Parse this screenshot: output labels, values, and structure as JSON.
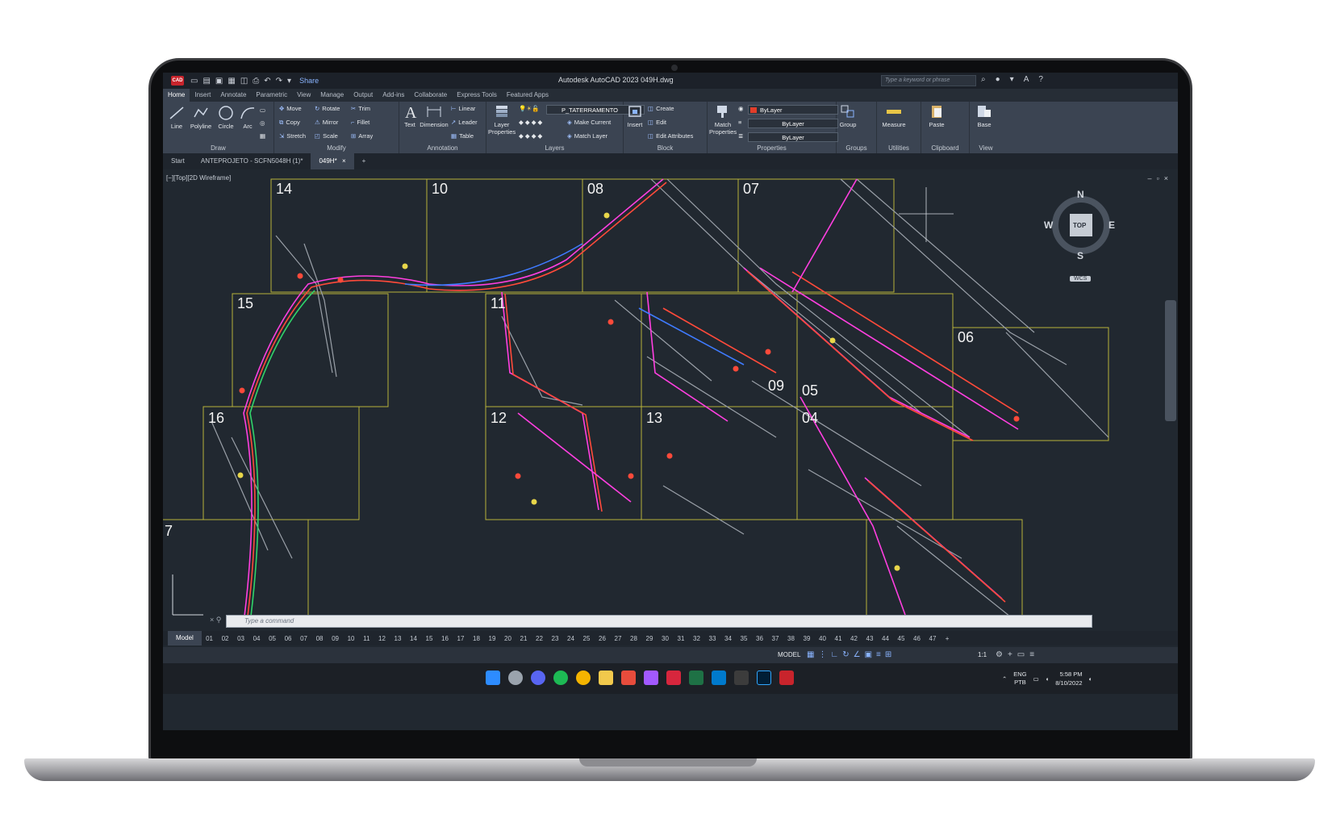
{
  "titlebar": {
    "logo": "CAD",
    "share": "Share",
    "title": "Autodesk AutoCAD 2023    049H.dwg",
    "search_placeholder": "Type a keyword or phrase"
  },
  "ribbon_tabs": [
    "Home",
    "Insert",
    "Annotate",
    "Parametric",
    "View",
    "Manage",
    "Output",
    "Add-ins",
    "Collaborate",
    "Express Tools",
    "Featured Apps"
  ],
  "draw": {
    "title": "Draw",
    "tools": [
      "Line",
      "Polyline",
      "Circle",
      "Arc"
    ]
  },
  "modify": {
    "title": "Modify",
    "col1": [
      "Move",
      "Copy",
      "Stretch"
    ],
    "col2": [
      "Rotate",
      "Mirror",
      "Scale"
    ],
    "col3": [
      "Trim",
      "Fillet",
      "Array"
    ]
  },
  "annotation": {
    "title": "Annotation",
    "tools": [
      "Text",
      "Dimension"
    ],
    "list": [
      "Linear",
      "Leader",
      "Table"
    ]
  },
  "layers": {
    "title": "Layers",
    "props_label": "Layer Properties",
    "current_layer": "P_TATERRAMENTO",
    "make_current": "Make Current",
    "match_layer": "Match Layer"
  },
  "block": {
    "title": "Block",
    "insert": "Insert",
    "items": [
      "Create",
      "Edit",
      "Edit Attributes"
    ]
  },
  "properties": {
    "title": "Properties",
    "match_label": "Match Properties",
    "color": "ByLayer",
    "linetype": "ByLayer",
    "lineweight": "ByLayer"
  },
  "groups": {
    "title": "Groups",
    "label": "Group"
  },
  "utilities": {
    "title": "Utilities",
    "label": "Measure"
  },
  "clipboard": {
    "title": "Clipboard",
    "label": "Paste"
  },
  "view": {
    "title": "View",
    "label": "Base"
  },
  "doc_tabs": [
    "Start",
    "ANTEPROJETO - SCFN5048H (1)*",
    "049H*"
  ],
  "viewport": {
    "label": "[−][Top][2D Wireframe]",
    "compass": {
      "n": "N",
      "s": "S",
      "e": "E",
      "w": "W",
      "center": "TOP",
      "wcs": "WCS"
    },
    "sheets": [
      "14",
      "10",
      "08",
      "07",
      "15",
      "11",
      "06",
      "16",
      "12",
      "13",
      "09",
      "05",
      "04",
      "7"
    ]
  },
  "command": {
    "placeholder": "Type a command"
  },
  "layout_tabs": {
    "model": "Model",
    "sheets": [
      "01",
      "02",
      "03",
      "04",
      "05",
      "06",
      "07",
      "08",
      "09",
      "10",
      "11",
      "12",
      "13",
      "14",
      "15",
      "16",
      "17",
      "18",
      "19",
      "20",
      "21",
      "22",
      "23",
      "24",
      "25",
      "26",
      "27",
      "28",
      "29",
      "30",
      "31",
      "32",
      "33",
      "34",
      "35",
      "36",
      "37",
      "38",
      "39",
      "40",
      "41",
      "42",
      "43",
      "44",
      "45",
      "46",
      "47"
    ]
  },
  "statusbar": {
    "model": "MODEL",
    "scale": "1:1"
  },
  "taskbar": {
    "lang1": "ENG",
    "lang2": "PTB",
    "time": "5:58 PM",
    "date": "8/10/2022"
  }
}
